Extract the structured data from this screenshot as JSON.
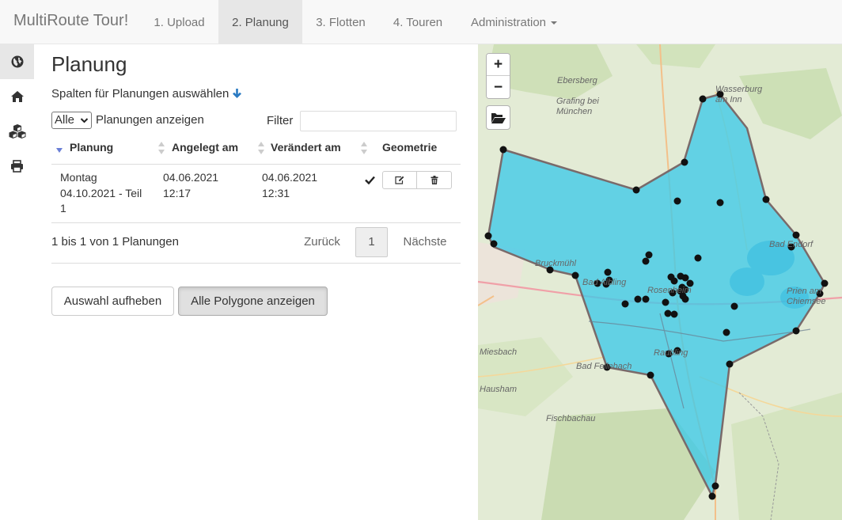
{
  "nav": {
    "brand": "MultiRoute Tour!",
    "items": [
      {
        "label": "1. Upload"
      },
      {
        "label": "2. Planung"
      },
      {
        "label": "3. Flotten"
      },
      {
        "label": "4. Touren"
      },
      {
        "label": "Administration"
      }
    ]
  },
  "sidebar": {
    "items": [
      "globe-icon",
      "home-icon",
      "cubes-icon",
      "print-icon"
    ]
  },
  "main": {
    "title": "Planung",
    "columns_link": "Spalten für Planungen auswählen",
    "length_value": "Alle",
    "length_label": "Planungen anzeigen",
    "filter_label": "Filter",
    "filter_value": "",
    "columns": [
      "Planung",
      "Angelegt am",
      "Verändert am",
      "Geometrie"
    ],
    "rows": [
      {
        "planung": [
          "Montag",
          "04.10.2021 - Teil",
          "1"
        ],
        "angelegt": [
          "04.06.2021",
          "12:17"
        ],
        "veraendert": [
          "04.06.2021",
          "12:31"
        ],
        "geometrie_icon": "check-icon"
      }
    ],
    "info": "1 bis 1 von 1 Planungen",
    "pagination": {
      "prev": "Zurück",
      "current": "1",
      "next": "Nächste"
    },
    "buttons": {
      "deselect": "Auswahl aufheben",
      "show_polygons": "Alle Polygone anzeigen"
    }
  },
  "map": {
    "zoom_in": "+",
    "zoom_out": "−",
    "labels": [
      "Ebersberg",
      "Wasserburg am Inn",
      "Grafing bei München",
      "Bruckmühl",
      "Bad Aibling",
      "Rosenheim",
      "Bad Endorf",
      "Prien am Chiemsee",
      "Raubling",
      "Miesbach",
      "Bad Feilnbach",
      "Hausham",
      "Fischbachau"
    ],
    "colors": {
      "polygon_fill": "#3ec9e8",
      "polygon_stroke": "#7a6a6a",
      "marker": "#111111"
    }
  }
}
